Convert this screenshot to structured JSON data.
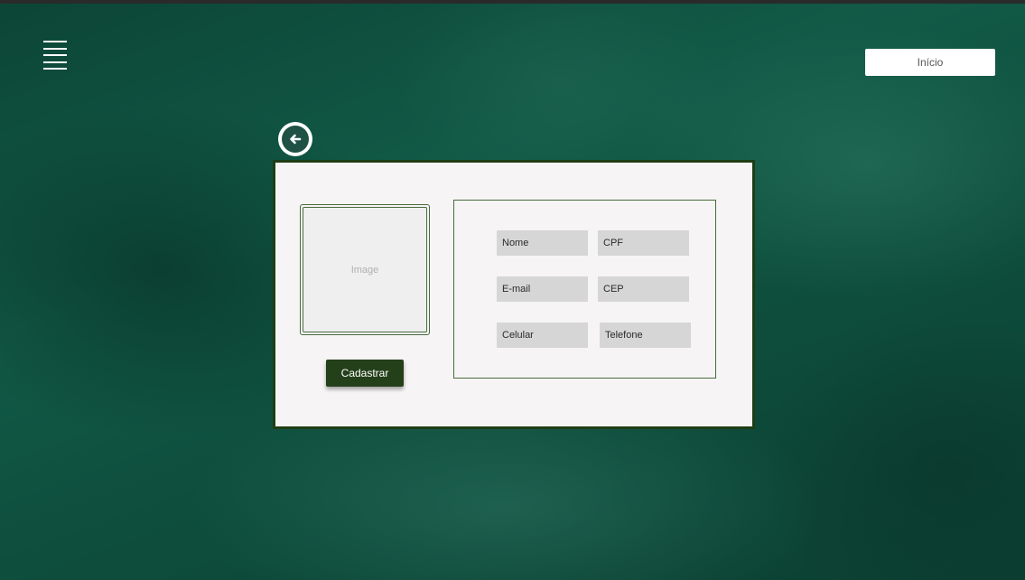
{
  "header": {
    "menu_icon": "hamburger-menu-icon",
    "home_label": "Início"
  },
  "nav": {
    "back_icon": "arrow-left-circle-icon"
  },
  "card": {
    "image_placeholder": "Image",
    "register_label": "Cadastrar",
    "fields": {
      "nome": "Nome",
      "cpf": "CPF",
      "email": "E-mail",
      "cep": "CEP",
      "celular": "Celular",
      "telefone": "Telefone"
    }
  },
  "colors": {
    "background": "#0f4a3a",
    "card_border": "#1f3d16",
    "button": "#24401a",
    "field": "#d6d6d6"
  }
}
